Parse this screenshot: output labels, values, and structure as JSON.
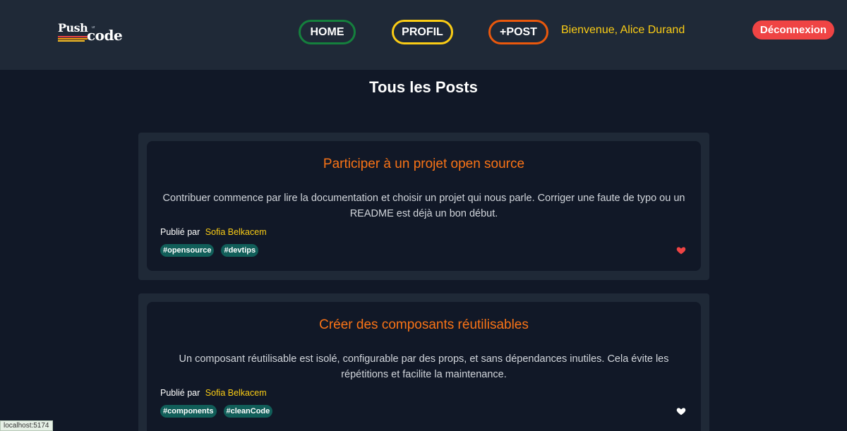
{
  "header": {
    "logo": {
      "word1": "Push",
      "word2": "code",
      "connector": "ur"
    },
    "nav": {
      "home": "HOME",
      "profil": "PROFIL",
      "post": "+POST"
    },
    "welcome": "Bienvenue, Alice Durand",
    "logout": "Déconnexion"
  },
  "page": {
    "title": "Tous les Posts"
  },
  "posts": [
    {
      "title": "Participer à un projet open source",
      "body": "Contribuer commence par lire la documentation et choisir un projet qui nous parle. Corriger une faute de typo ou un README est déjà un bon début.",
      "published_by": "Publié par",
      "author": "Sofia Belkacem",
      "tags": [
        "#opensource",
        "#devtips"
      ],
      "liked": true
    },
    {
      "title": "Créer des composants réutilisables",
      "body": "Un composant réutilisable est isolé, configurable par des props, et sans dépendances inutiles. Cela évite les répétitions et facilite la maintenance.",
      "published_by": "Publié par",
      "author": "Sofia Belkacem",
      "tags": [
        "#components",
        "#cleanCode"
      ],
      "liked": false
    }
  ],
  "status_bar": "localhost:5174",
  "colors": {
    "heart_liked": "#ef4444",
    "heart_unliked": "#ffffff"
  }
}
